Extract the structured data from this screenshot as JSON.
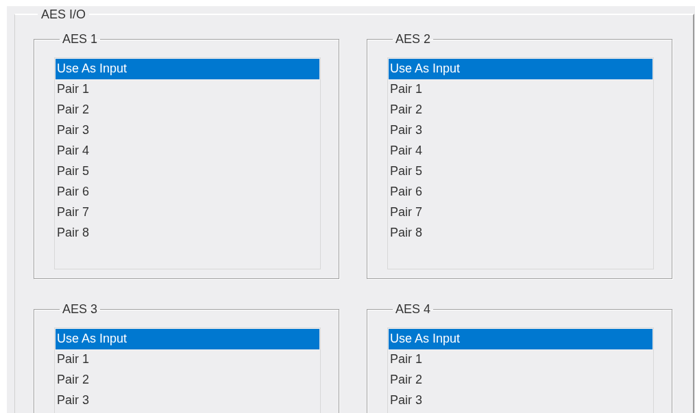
{
  "panel": {
    "title": "AES I/O"
  },
  "groups": [
    {
      "title": "AES 1",
      "items": [
        {
          "label": "Use As Input",
          "selected": true
        },
        {
          "label": "Pair 1",
          "selected": false
        },
        {
          "label": "Pair 2",
          "selected": false
        },
        {
          "label": "Pair 3",
          "selected": false
        },
        {
          "label": "Pair 4",
          "selected": false
        },
        {
          "label": "Pair 5",
          "selected": false
        },
        {
          "label": "Pair 6",
          "selected": false
        },
        {
          "label": "Pair 7",
          "selected": false
        },
        {
          "label": "Pair 8",
          "selected": false
        }
      ]
    },
    {
      "title": "AES 2",
      "items": [
        {
          "label": "Use As Input",
          "selected": true
        },
        {
          "label": "Pair 1",
          "selected": false
        },
        {
          "label": "Pair 2",
          "selected": false
        },
        {
          "label": "Pair 3",
          "selected": false
        },
        {
          "label": "Pair 4",
          "selected": false
        },
        {
          "label": "Pair 5",
          "selected": false
        },
        {
          "label": "Pair 6",
          "selected": false
        },
        {
          "label": "Pair 7",
          "selected": false
        },
        {
          "label": "Pair 8",
          "selected": false
        }
      ]
    },
    {
      "title": "AES 3",
      "items": [
        {
          "label": "Use As Input",
          "selected": true
        },
        {
          "label": "Pair 1",
          "selected": false
        },
        {
          "label": "Pair 2",
          "selected": false
        },
        {
          "label": "Pair 3",
          "selected": false
        }
      ]
    },
    {
      "title": "AES 4",
      "items": [
        {
          "label": "Use As Input",
          "selected": true
        },
        {
          "label": "Pair 1",
          "selected": false
        },
        {
          "label": "Pair 2",
          "selected": false
        },
        {
          "label": "Pair 3",
          "selected": false
        }
      ]
    }
  ]
}
